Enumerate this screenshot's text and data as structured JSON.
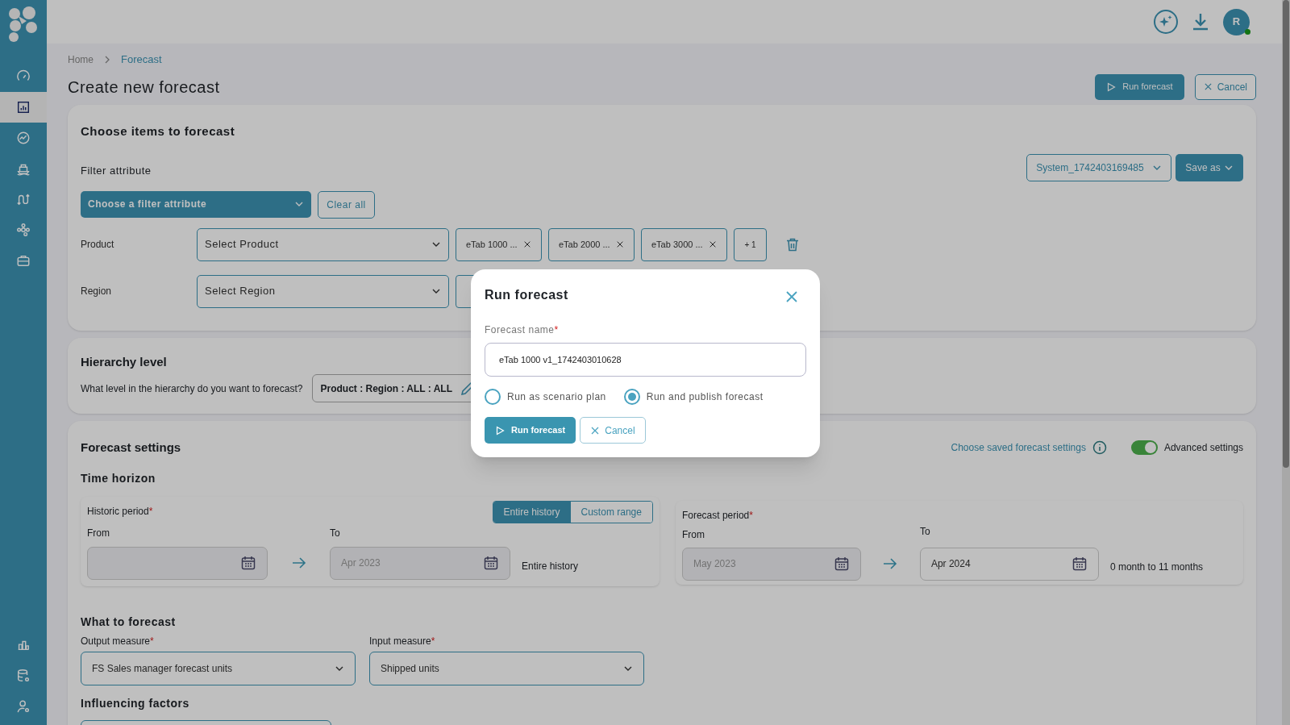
{
  "topbar": {
    "avatar": "R",
    "online": true
  },
  "sidebar": {
    "items": [
      {
        "selected": false
      },
      {
        "selected": true
      },
      {
        "selected": false
      },
      {
        "selected": false
      },
      {
        "selected": false
      },
      {
        "selected": false
      },
      {
        "selected": false
      }
    ],
    "bottom_items": [
      {
        "selected": false
      },
      {
        "selected": false
      },
      {
        "selected": false
      }
    ]
  },
  "breadcrumb": [
    "Home",
    "Forecast"
  ],
  "title": "Create new forecast",
  "header_buttons": {
    "run": "Run forecast",
    "cancel": "Cancel"
  },
  "choose_items": {
    "title": "Choose items to forecast",
    "filter_label": "Filter attribute",
    "filter_dropdown": "Choose a filter attribute",
    "clear": "Clear all",
    "saved_select": "System_1742403169485",
    "save_as": "Save as",
    "filters": [
      {
        "label": "Product",
        "select": "Select Product",
        "chips": [
          "eTab 1000 ...",
          "eTab 2000 ...",
          "eTab 3000 ..."
        ],
        "more": "+ 1"
      },
      {
        "label": "Region",
        "select": "Select Region"
      }
    ]
  },
  "hierarchy": {
    "title": "Hierarchy level",
    "question": "What level in the hierarchy do you want to forecast?",
    "value": "Product : Region : ALL : ALL"
  },
  "forecast_settings": {
    "title": "Forecast settings",
    "saved_link": "Choose saved forecast settings",
    "advanced": {
      "label": "Advanced settings",
      "on": true
    },
    "time_horizon": "Time horizon",
    "historic": {
      "label": "Historic period",
      "mark": "*",
      "modes": [
        {
          "label": "Entire history",
          "selected": true
        },
        {
          "label": "Custom range",
          "selected": false
        }
      ],
      "from_label": "From",
      "to_label": "To",
      "to_value": "Apr 2023",
      "note": "Entire history"
    },
    "forecast": {
      "label": "Forecast period",
      "mark": "*",
      "from_label": "From",
      "from_value": "May 2023",
      "to_label": "To",
      "to_value": "Apr 2024",
      "note": "0 month to 11 months"
    },
    "what_to_forecast": "What to forecast",
    "measures": [
      {
        "label": "Output measure",
        "mark": "*",
        "value": "FS Sales manager forecast units"
      },
      {
        "label": "Input measure",
        "mark": "*",
        "value": "Shipped units"
      }
    ],
    "influencing_factors": "Influencing factors"
  },
  "modal": {
    "title": "Run forecast",
    "field_label": "Forecast name",
    "mark": "*",
    "value": "eTab 1000 v1_1742403010628",
    "options": [
      {
        "label": "Run as scenario plan",
        "selected": false
      },
      {
        "label": "Run and publish forecast",
        "selected": true
      }
    ],
    "run": "Run forecast",
    "cancel": "Cancel"
  }
}
